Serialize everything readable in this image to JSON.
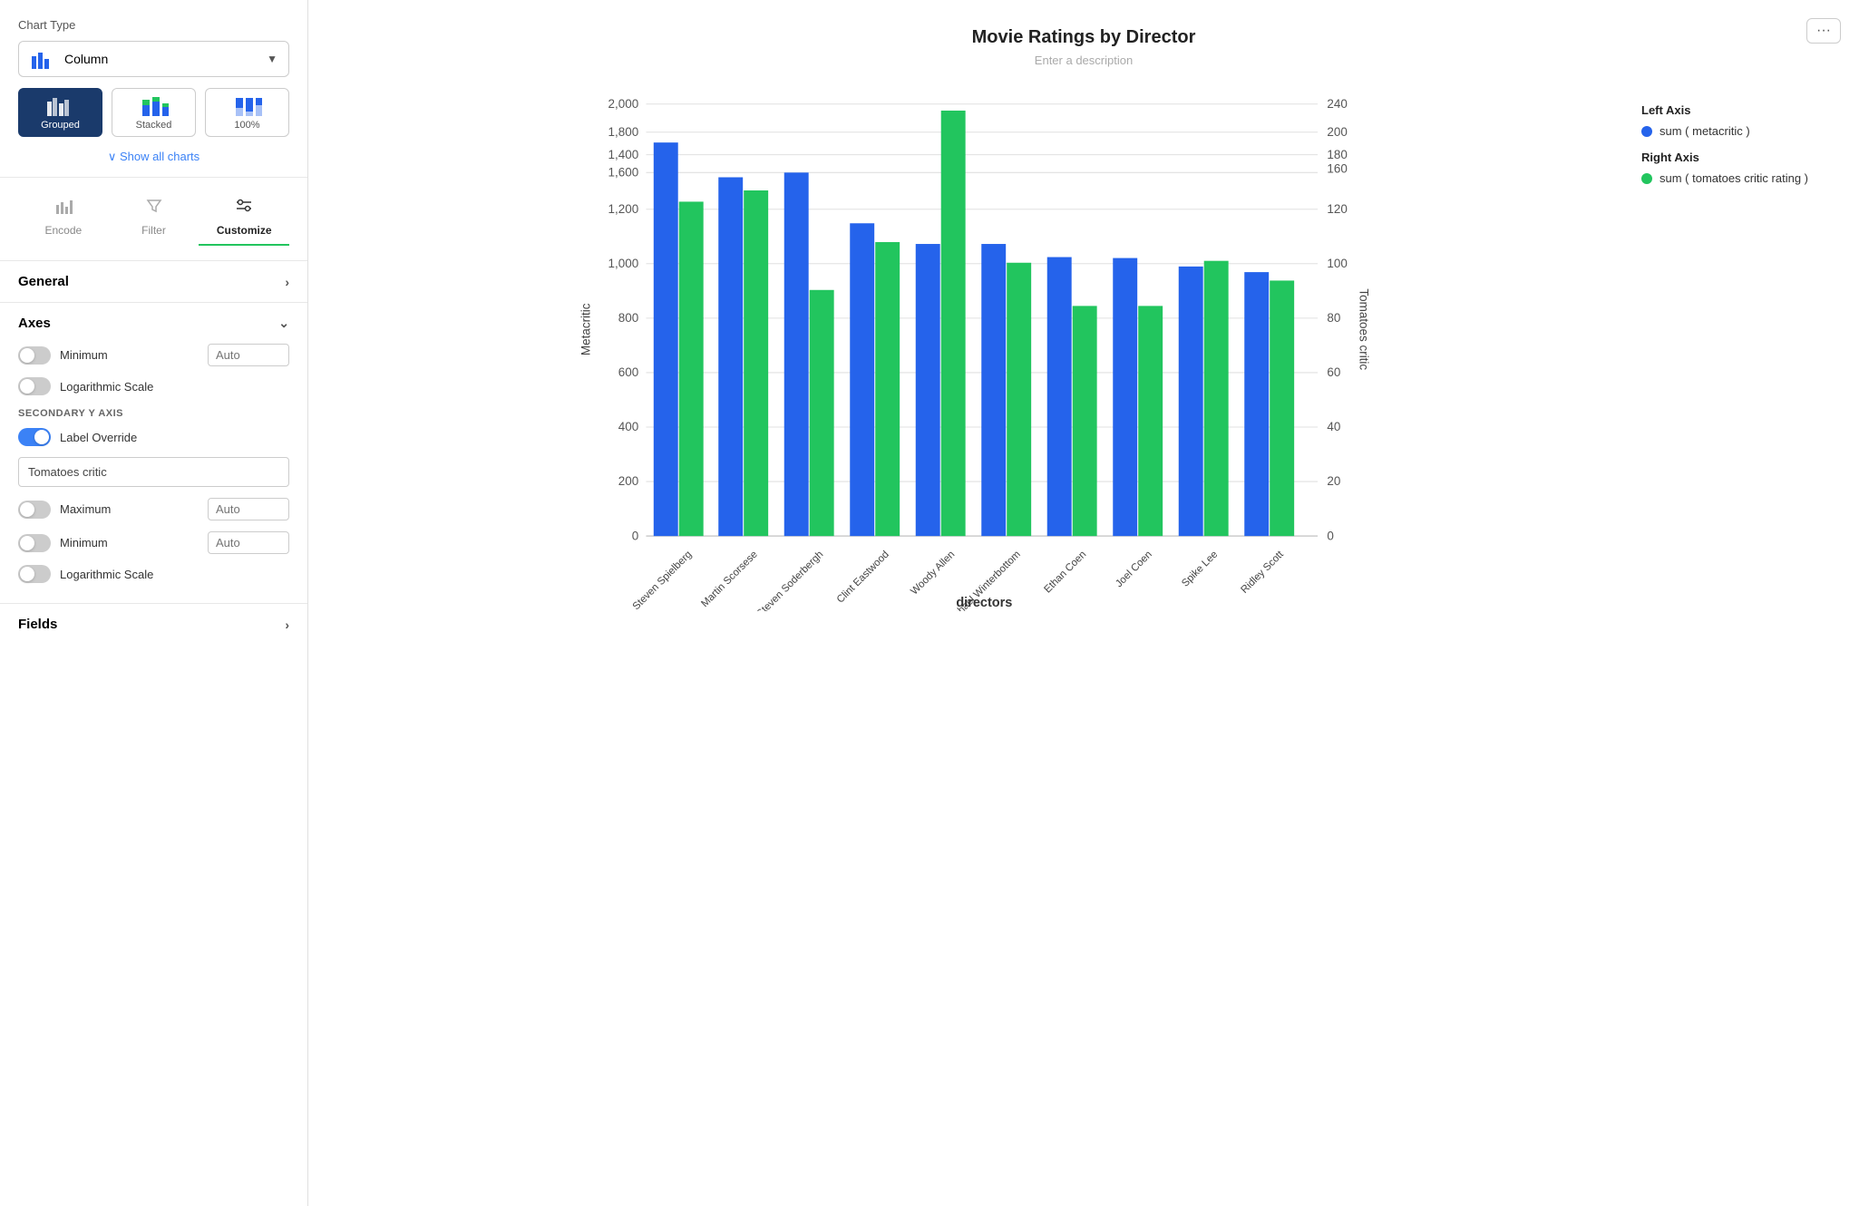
{
  "sidebar": {
    "chart_type_label": "Chart Type",
    "chart_type_selected": "Column",
    "show_all_charts": "∨  Show all charts",
    "chart_styles": [
      {
        "id": "grouped",
        "label": "Grouped",
        "active": true
      },
      {
        "id": "stacked",
        "label": "Stacked",
        "active": false
      },
      {
        "id": "100pct",
        "label": "100%",
        "active": false
      }
    ],
    "tabs": [
      {
        "id": "encode",
        "label": "Encode",
        "icon": "📊"
      },
      {
        "id": "filter",
        "label": "Filter",
        "icon": "▽"
      },
      {
        "id": "customize",
        "label": "Customize",
        "icon": "⊞",
        "active": true
      }
    ],
    "sections": {
      "general": {
        "label": "General",
        "expanded": false
      },
      "axes": {
        "label": "Axes",
        "expanded": true
      },
      "fields": {
        "label": "Fields",
        "expanded": false
      }
    },
    "axes": {
      "minimum_label": "Minimum",
      "minimum_toggle": false,
      "minimum_input": "Auto",
      "log_scale_label": "Logarithmic Scale",
      "log_scale_toggle": false,
      "secondary_y_title": "SECONDARY Y AXIS",
      "label_override_label": "Label Override",
      "label_override_toggle": true,
      "label_override_input": "Tomatoes critic",
      "maximum_label": "Maximum",
      "maximum_toggle": false,
      "maximum_input": "Auto",
      "minimum2_label": "Minimum",
      "minimum2_toggle": false,
      "minimum2_input": "Auto",
      "log_scale2_label": "Logarithmic Scale",
      "log_scale2_toggle": false
    }
  },
  "chart": {
    "title": "Movie Ratings by Director",
    "description": "Enter a description",
    "x_axis_label": "directors",
    "y_left_label": "Metacritic",
    "y_right_label": "Tomatoes critic",
    "more_button": "···",
    "directors": [
      "Steven Spielberg",
      "Martin Scorsese",
      "Steven Soderbergh",
      "Clint Eastwood",
      "Woody Allen",
      "Michael Winterbottom",
      "Ethan Coen",
      "Joel Coen",
      "Spike Lee",
      "Ridley Scott"
    ],
    "blue_values": [
      1820,
      1660,
      1680,
      1450,
      1350,
      1350,
      1290,
      1285,
      1245,
      1220
    ],
    "green_values": [
      1550,
      1600,
      1140,
      1360,
      1970,
      1265,
      1065,
      1065,
      1275,
      1185
    ],
    "y_left_max": 2000,
    "y_right_max": 240,
    "legend": {
      "left_axis_title": "Left Axis",
      "left_axis_item": "sum ( metacritic )",
      "right_axis_title": "Right Axis",
      "right_axis_item": "sum ( tomatoes critic rating )",
      "blue_color": "#2563eb",
      "green_color": "#22c55e"
    }
  }
}
